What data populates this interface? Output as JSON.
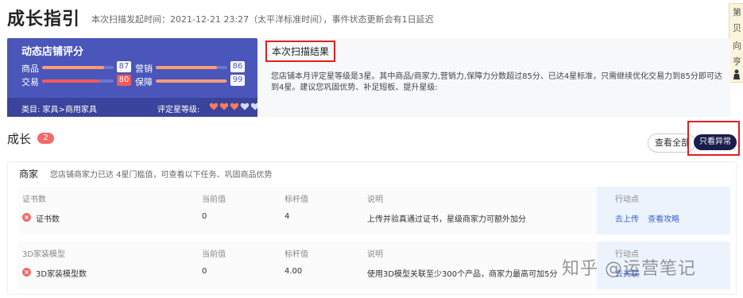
{
  "header": {
    "title": "成长指引",
    "scan_info": "本次扫描发起时间：2021-12-21 23:27（太平洋标准时间），事件状态更新会有1日延迟"
  },
  "right_edge": {
    "glyphs": [
      "第",
      "贝",
      "向",
      "亨"
    ]
  },
  "score_card": {
    "title": "动态店铺评分",
    "metrics": [
      {
        "label": "商品",
        "value": "87",
        "fill": 0.87,
        "status": "normal"
      },
      {
        "label": "营销",
        "value": "86",
        "fill": 0.86,
        "status": "normal"
      },
      {
        "label": "交易",
        "value": "80",
        "fill": 0.8,
        "status": "warn"
      },
      {
        "label": "保障",
        "value": "99",
        "fill": 0.99,
        "status": "normal"
      }
    ],
    "category": "类目: 家具>商用家具",
    "grade_label": "评定星等级:",
    "hearts": {
      "filled": 3,
      "total": 5
    },
    "colors": {
      "card_bg": "#4a56b9",
      "bar_fill": "#ff9c74",
      "warn": "#f45a5a"
    }
  },
  "result": {
    "label": "本次扫描结果",
    "text": "您店铺本月评定星等级是3星。其中商品/商家力,营销力,保障力分数超过85分、已达4星标准，只需继续优化交易力到85分即可达到4星。建议您巩固优势、补足短板、提升星级:"
  },
  "growth": {
    "title": "成长",
    "badge": "2",
    "view_all": "查看全部",
    "only_abnormal": "只看异常"
  },
  "section": {
    "head": "商家",
    "desc": "您店铺商家力已达 4星门槛值，可查看以下任务、巩固商品优势",
    "tables": [
      {
        "headers": [
          "证书数",
          "当前值",
          "标杆值",
          "说明",
          "行动点"
        ],
        "row": {
          "name": "证书数",
          "current": "0",
          "benchmark": "4",
          "desc": "上传并验真通过证书，星级商家力可额外加分",
          "actions": [
            "去上传",
            "查看攻略"
          ]
        }
      },
      {
        "headers": [
          "3D家装模型",
          "当前值",
          "标杆值",
          "说明",
          "行动点"
        ],
        "row": {
          "name": "3D家装模型数",
          "current": "0",
          "benchmark": "4.00",
          "desc": "使用3D模型关联至少300个产品，商家力最高可加5分",
          "actions": [
            "去关联"
          ]
        }
      }
    ]
  },
  "watermark": "知乎 @运营笔记"
}
